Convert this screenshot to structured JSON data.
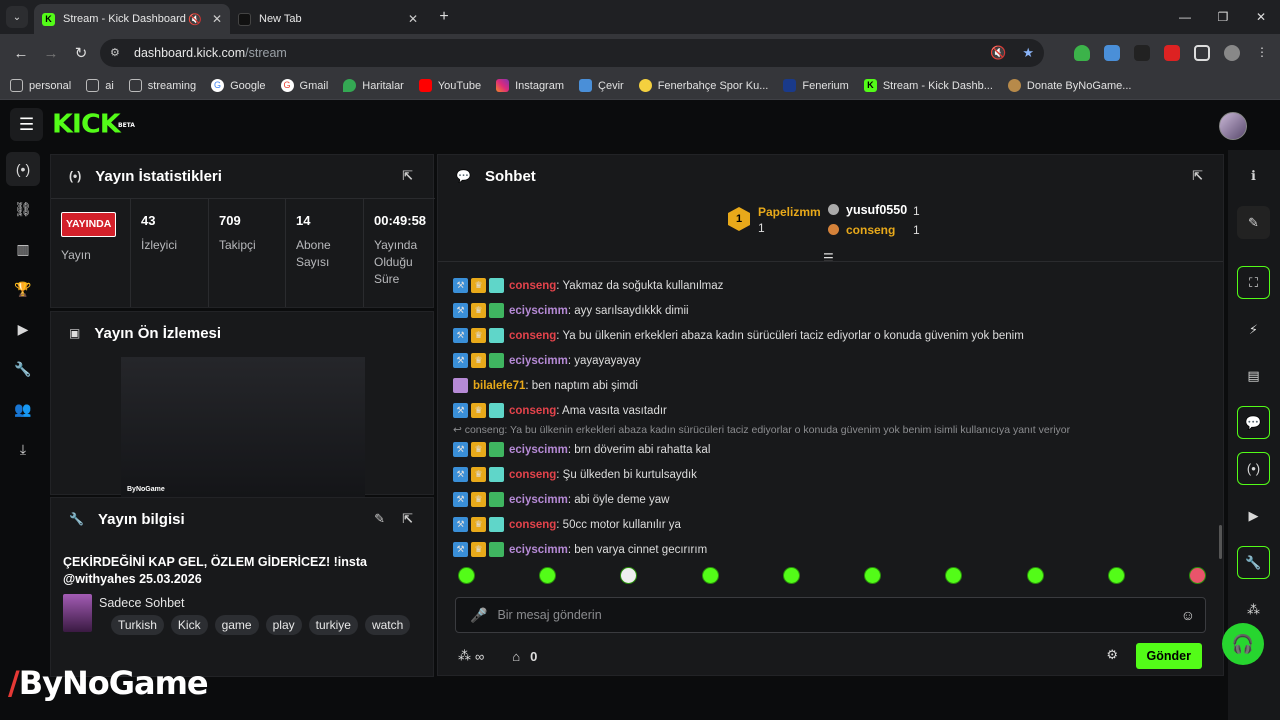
{
  "browser": {
    "tabs": [
      {
        "title": "Stream - Kick Dashboard",
        "active": true
      },
      {
        "title": "New Tab",
        "active": false
      }
    ],
    "url_host": "dashboard.kick.com",
    "url_path": "/stream",
    "bookmarks": [
      "personal",
      "ai",
      "streaming",
      "Google",
      "Gmail",
      "Haritalar",
      "YouTube",
      "Instagram",
      "Çevir",
      "Fenerbahçe Spor Ku...",
      "Fenerium",
      "Stream - Kick Dashb...",
      "Donate ByNoGame..."
    ]
  },
  "app": {
    "logo": "KICK",
    "logo_sup": "BETA"
  },
  "stats": {
    "title": "Yayın İstatistikleri",
    "live_badge": "YAYINDA",
    "live_label": "Yayın",
    "viewers": "43",
    "viewers_label": "İzleyici",
    "followers": "709",
    "followers_label": "Takipçi",
    "subs": "14",
    "subs_label": "Abone Sayısı",
    "uptime": "00:49:58",
    "uptime_label": "Yayında Olduğu Süre"
  },
  "preview": {
    "title": "Yayın Ön İzlemesi",
    "watermark": "ByNoGame"
  },
  "info": {
    "title": "Yayın bilgisi",
    "stream_title": "ÇEKİRDEĞİNİ KAP GEL, ÖZLEM GİDERİCEZ! !insta @withyahes 25.03.2026",
    "category": "Sadece Sohbet",
    "tags": [
      "Turkish",
      "Kick",
      "game",
      "play",
      "turkiye",
      "watch"
    ]
  },
  "chat": {
    "title": "Sohbet",
    "leader_1_name": "Papelizmm",
    "leader_1_count": "1",
    "leader_1_rank": "1",
    "leader_2_name": "yusuf0550",
    "leader_2_count": "1",
    "leader_3_name": "conseng",
    "leader_3_count": "1",
    "messages": [
      {
        "user": "conseng",
        "color": "#e3434b",
        "text": ": Yakmaz da soğukta kullanılmaz"
      },
      {
        "user": "eciyscimm",
        "color": "#b68ad6",
        "text": ": ayy sarılsaydıkkk dimii"
      },
      {
        "user": "conseng",
        "color": "#e3434b",
        "text": ": Ya bu ülkenin erkekleri abaza kadın sürücüleri taciz ediyorlar o konuda güvenim yok benim"
      },
      {
        "user": "eciyscimm",
        "color": "#b68ad6",
        "text": ": yayayayayay"
      },
      {
        "user": "bilalefe71",
        "color": "#e8a91a",
        "text": ": ben naptım abi şimdi"
      },
      {
        "user": "conseng",
        "color": "#e3434b",
        "text": ": Ama vasıta vasıtadır"
      },
      {
        "user": "eciyscimm",
        "color": "#b68ad6",
        "text": ": brn döverim abi rahatta kal"
      },
      {
        "user": "conseng",
        "color": "#e3434b",
        "text": ": Şu ülkeden bi kurtulsaydık"
      },
      {
        "user": "eciyscimm",
        "color": "#b68ad6",
        "text": ": abi öyle deme yaw"
      },
      {
        "user": "conseng",
        "color": "#e3434b",
        "text": ": 50cc motor kullanılır ya"
      },
      {
        "user": "eciyscimm",
        "color": "#b68ad6",
        "text": ": ben varya cinnet gecırırım"
      }
    ],
    "reply_preview": "conseng: Ya bu ülkenin erkekleri abaza kadın sürücüleri taciz ediyorlar o konuda güvenim yok benim isimli kullanıcıya yanıt veriyor",
    "input_placeholder": "Bir mesaj gönderin",
    "points": "∞",
    "store_count": "0",
    "send_label": "Gönder"
  },
  "watermark": "ByNoGame",
  "colors": {
    "accent": "#53fc18",
    "live": "#d3202a"
  }
}
